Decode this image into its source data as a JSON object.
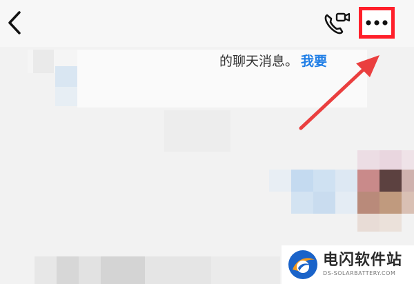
{
  "header": {
    "back_icon": "chevron-left-icon",
    "video_call_icon": "video-call-icon",
    "more_icon": "more-dots-icon"
  },
  "notice": {
    "text": "的聊天消息。",
    "link": "我要"
  },
  "annotation": {
    "highlight_color": "#ff1f2a",
    "arrow_color": "#ea3f3f"
  },
  "watermark": {
    "title": "电闪软件站",
    "subtitle": "DS-SOLARBATTERY.COM"
  },
  "colors": {
    "link": "#1f7ee6",
    "background": "#f2f2f2"
  }
}
